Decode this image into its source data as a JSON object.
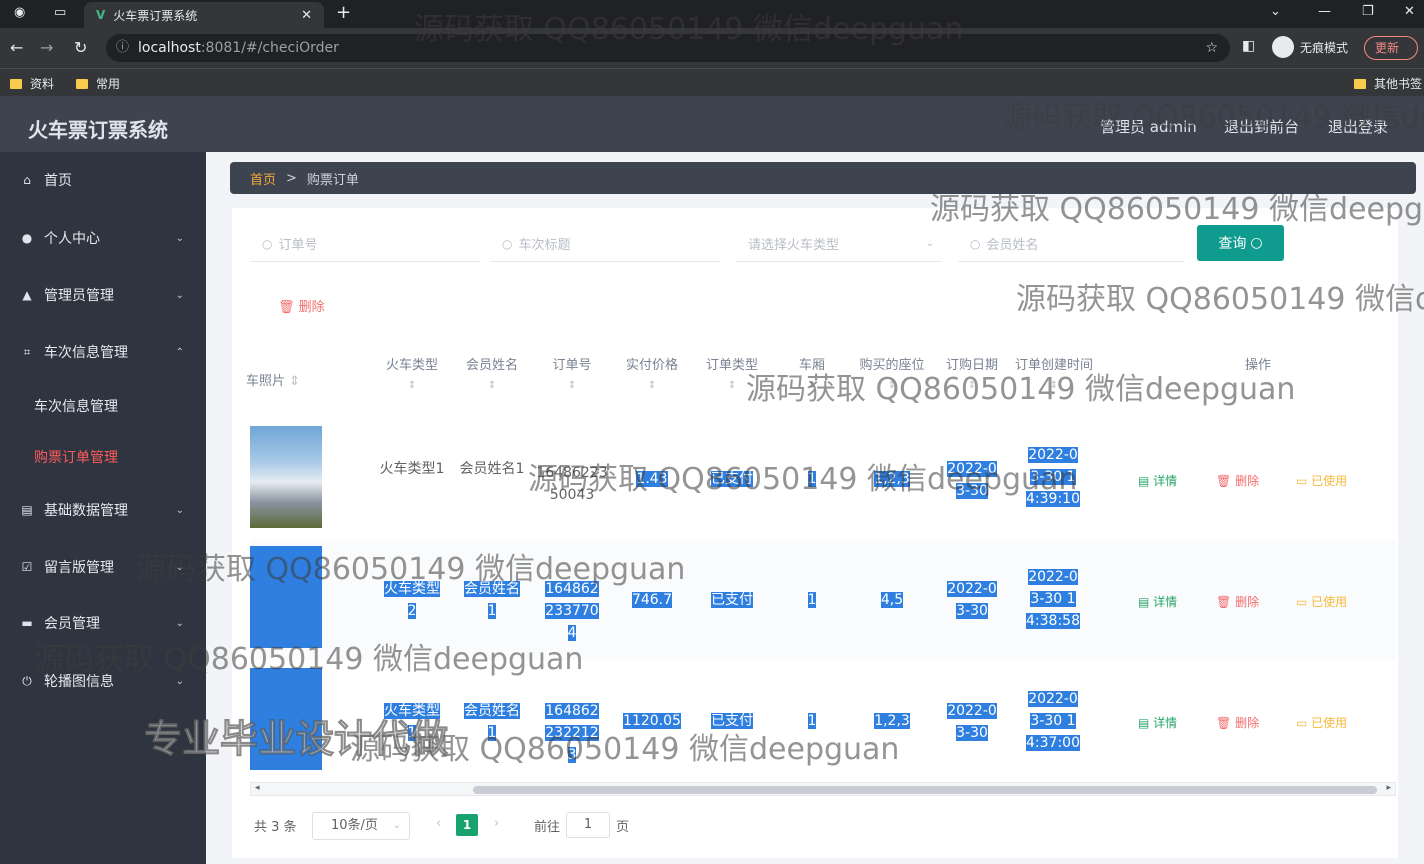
{
  "browser": {
    "tab_title": "火车票订票系统",
    "url_host": "localhost",
    "url_path": ":8081/#/checiOrder",
    "incognito_label": "无痕模式",
    "update_label": "更新",
    "bookmarks": [
      "资料",
      "常用"
    ],
    "other_bookmarks": "其他书签"
  },
  "app": {
    "title": "火车票订票系统",
    "header_links": [
      "管理员 admin",
      "退出到前台",
      "退出登录"
    ]
  },
  "sidebar": {
    "items": [
      {
        "label": "首页",
        "icon": "home-icon"
      },
      {
        "label": "个人中心",
        "icon": "user-icon"
      },
      {
        "label": "管理员管理",
        "icon": "admin-icon"
      },
      {
        "label": "车次信息管理",
        "icon": "crop-icon"
      },
      {
        "label": "基础数据管理",
        "icon": "document-icon"
      },
      {
        "label": "留言版管理",
        "icon": "checklist-icon"
      },
      {
        "label": "会员管理",
        "icon": "monitor-icon"
      },
      {
        "label": "轮播图信息",
        "icon": "power-icon"
      }
    ],
    "sub_items": [
      "车次信息管理",
      "购票订单管理"
    ]
  },
  "breadcrumb": {
    "home": "首页",
    "current": "购票订单"
  },
  "search": {
    "order_no_placeholder": "订单号",
    "train_title_placeholder": "车次标题",
    "train_type_placeholder": "请选择火车类型",
    "member_name_placeholder": "会员姓名",
    "query_label": "查询"
  },
  "delete_label": "删除",
  "table": {
    "headers": [
      "车照片",
      "火车类型",
      "会员姓名",
      "订单号",
      "实付价格",
      "订单类型",
      "车厢",
      "购买的座位",
      "订购日期",
      "订单创建时间",
      "操作"
    ],
    "rows": [
      {
        "train_type": "火车类型1",
        "member": "会员姓名1",
        "order_no": "1648622350043",
        "price": "1.43",
        "status": "已支付",
        "carriage": "1",
        "seats": "1,2,3",
        "date": "2022-03-30",
        "created": "2022-03-30 14:39:10"
      },
      {
        "train_type": "火车类型2",
        "member": "会员姓名1",
        "order_no": "1648622337704",
        "price": "746.7",
        "status": "已支付",
        "carriage": "1",
        "seats": "4,5",
        "date": "2022-03-30",
        "created": "2022-03-30 14:38:58"
      },
      {
        "train_type": "火车类型1",
        "member": "会员姓名1",
        "order_no": "1648622322123",
        "price": "1120.05",
        "status": "已支付",
        "carriage": "1",
        "seats": "1,2,3",
        "date": "2022-03-30",
        "created": "2022-03-30 14:37:00"
      }
    ],
    "actions": {
      "detail": "详情",
      "delete": "删除",
      "used": "已使用"
    }
  },
  "pagination": {
    "total": "共 3 条",
    "page_size": "10条/页",
    "current_page": "1",
    "goto_prefix": "前往",
    "goto_value": "1",
    "goto_suffix": "页"
  },
  "watermarks": {
    "text": "源码获取 QQ86050149 微信deepguan",
    "badge": "专业毕业设计代做"
  }
}
